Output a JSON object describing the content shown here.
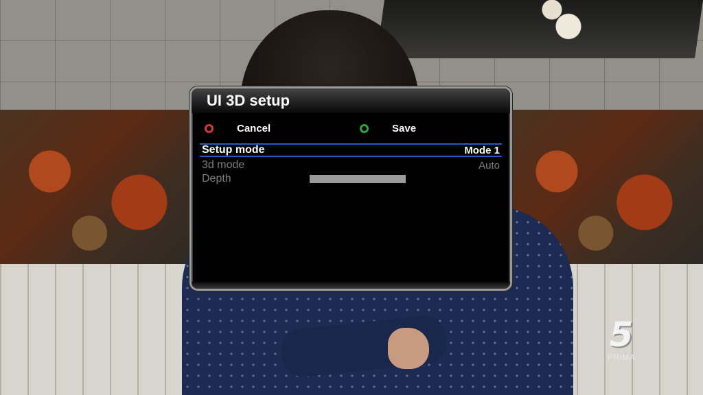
{
  "dialog": {
    "title": "UI 3D setup",
    "buttons": {
      "cancel": {
        "label": "Cancel",
        "color": "#d23a3a"
      },
      "save": {
        "label": "Save",
        "color": "#2fa63a"
      }
    },
    "rows": [
      {
        "label": "Setup mode",
        "value": "Mode 1",
        "selected": true
      },
      {
        "label": "3d mode",
        "value": "Auto",
        "selected": false
      },
      {
        "label": "Depth",
        "value_fraction": 1.0,
        "selected": false
      }
    ],
    "accent_color": "#2a56c8"
  },
  "channel_logo": {
    "number": "5",
    "name": "PRIMA"
  }
}
